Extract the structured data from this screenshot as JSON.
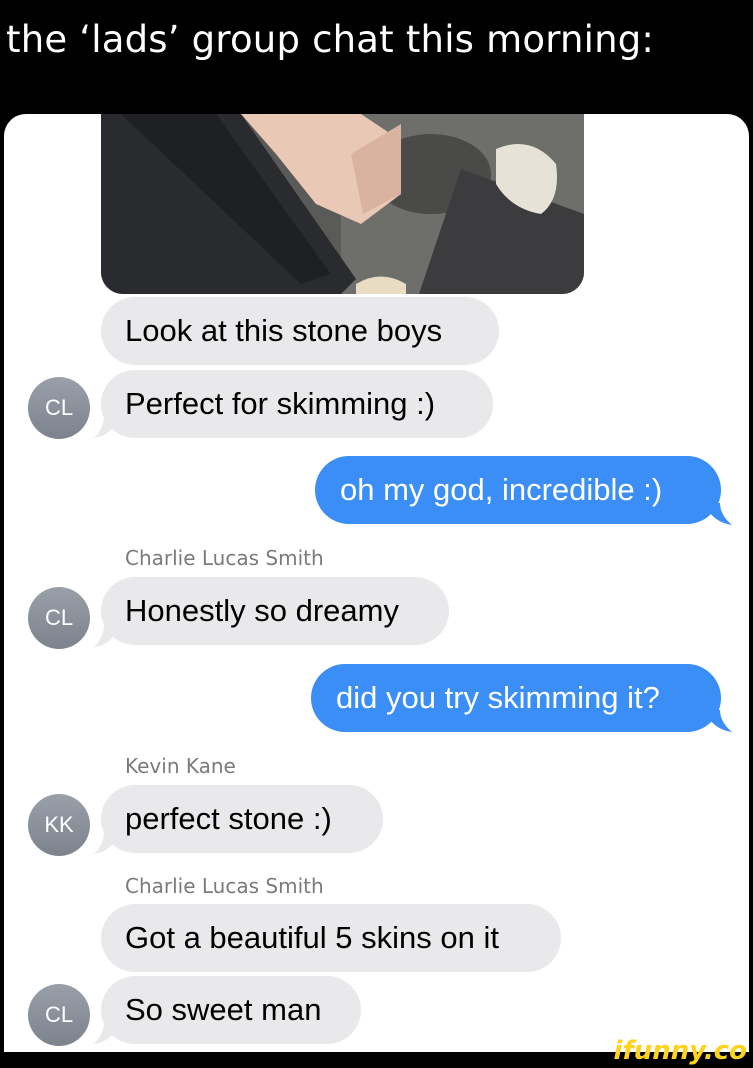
{
  "caption": "the ‘lads’ group chat this morning:",
  "messages": [
    {
      "text": "Look at this stone boys"
    },
    {
      "text": "Perfect for skimming :)",
      "avatar": "CL"
    },
    {
      "text": "oh my god, incredible :)"
    },
    {
      "sender": "Charlie Lucas Smith",
      "text": "Honestly so dreamy",
      "avatar": "CL"
    },
    {
      "text": "did you try skimming it?"
    },
    {
      "sender": "Kevin Kane",
      "text": "perfect stone :)",
      "avatar": "KK"
    },
    {
      "sender": "Charlie Lucas Smith",
      "text": "Got a beautiful 5 skins on it"
    },
    {
      "text": "So sweet man",
      "avatar": "CL"
    }
  ],
  "watermark": "ifunny.co",
  "colors": {
    "incoming": "#e9e9eb",
    "outgoing": "#3b8ef5",
    "background": "#000000"
  }
}
